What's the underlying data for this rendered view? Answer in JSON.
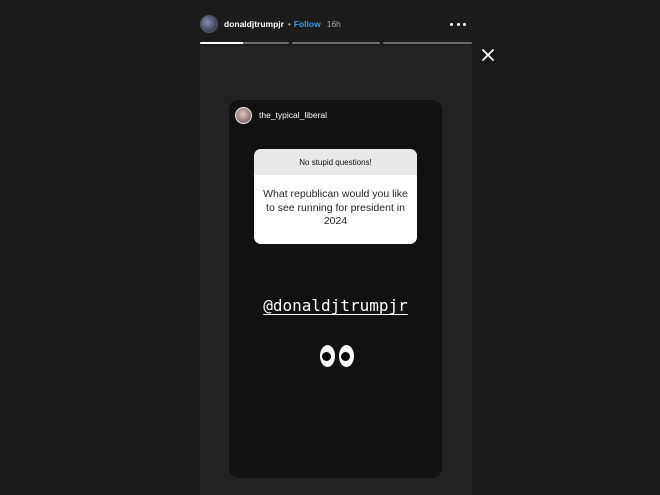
{
  "header": {
    "username": "donaldjtrumpjr",
    "separator": "•",
    "follow_label": "Follow",
    "time": "16h"
  },
  "progress": {
    "segments": 3,
    "current_index": 0,
    "current_fill": 0.48
  },
  "card": {
    "username": "the_typical_liberal",
    "question_header": "No stupid questions!",
    "question_text": "What republican would you like to see running for president in 2024",
    "mention": "@donaldjtrumpjr",
    "emoji": "👀"
  },
  "icons": {
    "more": "more-dots-icon",
    "close": "close-icon"
  },
  "colors": {
    "background": "#1a1a1a",
    "follow": "#3897f0",
    "card": "#111111"
  }
}
